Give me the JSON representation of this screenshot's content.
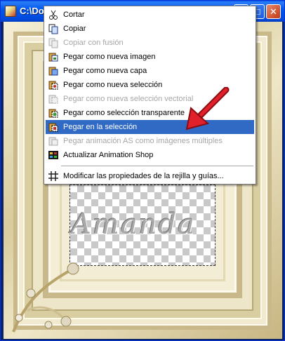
{
  "window": {
    "title": "C:\\Doc",
    "buttons": {
      "minimize": "_",
      "maximize": "□",
      "close": "✕"
    }
  },
  "canvas": {
    "watermark": "Amanda"
  },
  "menu": {
    "items": [
      {
        "label": "Cortar",
        "icon": "scissors-icon",
        "disabled": false
      },
      {
        "label": "Copiar",
        "icon": "copy-icon",
        "disabled": false
      },
      {
        "label": "Copiar con fusión",
        "icon": "copy-merged-icon",
        "disabled": true
      },
      {
        "label": "Pegar como nueva imagen",
        "icon": "paste-new-image-icon",
        "disabled": false
      },
      {
        "label": "Pegar como nueva capa",
        "icon": "paste-new-layer-icon",
        "disabled": false
      },
      {
        "label": "Pegar como nueva selección",
        "icon": "paste-new-selection-icon",
        "disabled": false
      },
      {
        "label": "Pegar como nueva selección vectorial",
        "icon": "paste-vector-selection-icon",
        "disabled": true
      },
      {
        "label": "Pegar como selección transparente",
        "icon": "paste-transparent-selection-icon",
        "disabled": false
      },
      {
        "label": "Pegar en la selección",
        "icon": "paste-into-selection-icon",
        "disabled": false,
        "selected": true
      },
      {
        "label": "Pegar animación AS como imágenes múltiples",
        "icon": "paste-animation-icon",
        "disabled": true
      },
      {
        "label": "Actualizar Animation Shop",
        "icon": "animation-shop-icon",
        "disabled": false
      },
      {
        "label": "Modificar las propiedades de la rejilla y guías...",
        "icon": "grid-icon",
        "disabled": false
      }
    ]
  },
  "colors": {
    "selection": "#316ac5",
    "titlebar": "#0058ee",
    "arrow": "#d0141e"
  }
}
